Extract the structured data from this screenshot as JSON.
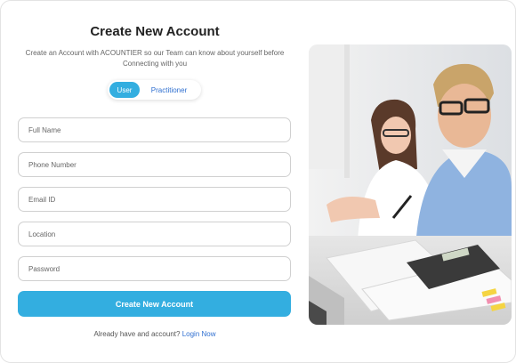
{
  "form": {
    "title": "Create New Account",
    "subtitle": "Create an Account with ACOUNTIER so our Team can know about yourself before Connecting with you",
    "toggle": {
      "user_label": "User",
      "practitioner_label": "Practitioner",
      "selected": "User"
    },
    "fields": {
      "full_name": {
        "placeholder": "Full Name"
      },
      "phone": {
        "placeholder": "Phone Number"
      },
      "email": {
        "placeholder": "Email ID"
      },
      "location": {
        "placeholder": "Location"
      },
      "password": {
        "placeholder": "Password"
      }
    },
    "submit_label": "Create New Account",
    "login_prompt": "Already have and account?",
    "login_link": "Login Now"
  },
  "colors": {
    "accent": "#33aee0",
    "link": "#2f6fd0",
    "border": "#d0d0d0"
  }
}
